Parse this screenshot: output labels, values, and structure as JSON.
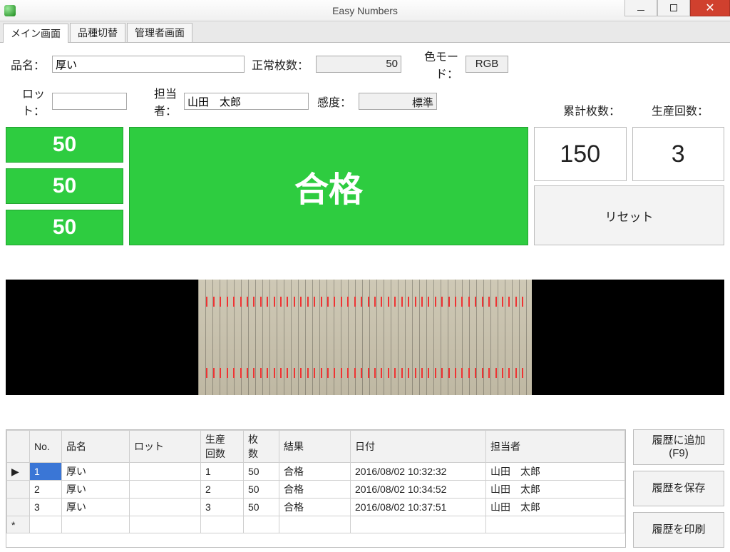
{
  "window": {
    "title": "Easy Numbers"
  },
  "tabs": [
    "メイン画面",
    "品種切替",
    "管理者画面"
  ],
  "form": {
    "labels": {
      "hinmei": "品名：",
      "lot": "ロット：",
      "tantou": "担当者：",
      "seijou": "正常枚数：",
      "kando": "感度：",
      "colormode": "色モード："
    },
    "values": {
      "hinmei": "厚い",
      "lot": "",
      "tantou": "山田　太郎",
      "seijou": "50",
      "kando": "標準",
      "colormode": "RGB"
    }
  },
  "stats": {
    "ruikei_label": "累計枚数：",
    "seisan_label": "生産回数：",
    "ruikei": "150",
    "seisan": "3"
  },
  "counts": [
    "50",
    "50",
    "50"
  ],
  "result": "合格",
  "buttons": {
    "reset": "リセット",
    "add_history": "履歴に追加\n(F9)",
    "save_history": "履歴を保存",
    "print_history": "履歴を印刷"
  },
  "grid": {
    "headers": [
      "No.",
      "品名",
      "ロット",
      "生産\n回数",
      "枚\n数",
      "結果",
      "日付",
      "担当者"
    ],
    "rows": [
      {
        "no": "1",
        "hinmei": "厚い",
        "lot": "",
        "seisan": "1",
        "maisuu": "50",
        "kekka": "合格",
        "date": "2016/08/02 10:32:32",
        "tantou": "山田　太郎"
      },
      {
        "no": "2",
        "hinmei": "厚い",
        "lot": "",
        "seisan": "2",
        "maisuu": "50",
        "kekka": "合格",
        "date": "2016/08/02 10:34:52",
        "tantou": "山田　太郎"
      },
      {
        "no": "3",
        "hinmei": "厚い",
        "lot": "",
        "seisan": "3",
        "maisuu": "50",
        "kekka": "合格",
        "date": "2016/08/02 10:37:51",
        "tantou": "山田　太郎"
      }
    ]
  }
}
